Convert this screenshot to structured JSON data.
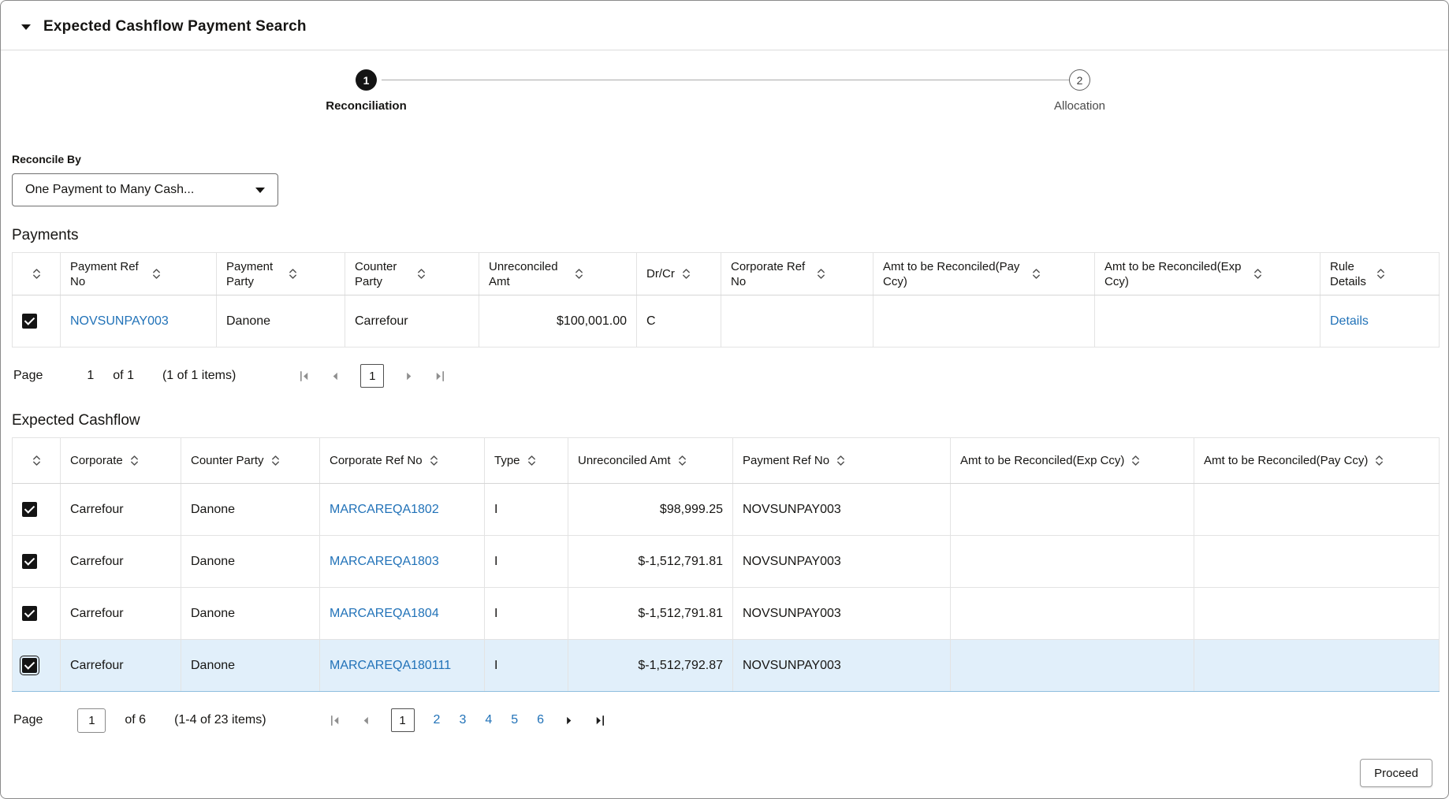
{
  "header": {
    "title": "Expected Cashflow Payment Search"
  },
  "stepper": {
    "steps": [
      {
        "number": "1",
        "label": "Reconciliation",
        "state": "active"
      },
      {
        "number": "2",
        "label": "Allocation",
        "state": "inactive"
      }
    ]
  },
  "reconcile_by": {
    "label": "Reconcile By",
    "value": "One Payment to Many Cash..."
  },
  "payments": {
    "title": "Payments",
    "columns": [
      "Payment Ref No",
      "Payment Party",
      "Counter Party",
      "Unreconciled Amt",
      "Dr/Cr",
      "Corporate Ref No",
      "Amt to be Reconciled(Pay Ccy)",
      "Amt to be Reconciled(Exp Ccy)",
      "Rule Details"
    ],
    "rows": [
      {
        "checked": true,
        "payment_ref_no": "NOVSUNPAY003",
        "payment_party": "Danone",
        "counter_party": "Carrefour",
        "unreconciled_amt": "$100,001.00",
        "dr_cr": "C",
        "corporate_ref_no": "",
        "amt_to_be_reconciled_pay_ccy": "",
        "amt_to_be_reconciled_exp_ccy": "",
        "rule_details": "Details"
      }
    ],
    "pagination": {
      "page_label": "Page",
      "page": "1",
      "of_label": "of 1",
      "items_label": "(1 of 1 items)",
      "pages": [
        "1"
      ]
    }
  },
  "expected_cashflow": {
    "title": "Expected Cashflow",
    "columns": [
      "Corporate",
      "Counter Party",
      "Corporate Ref No",
      "Type",
      "Unreconciled Amt",
      "Payment Ref No",
      "Amt to be Reconciled(Exp Ccy)",
      "Amt to be Reconciled(Pay Ccy)"
    ],
    "rows": [
      {
        "checked": true,
        "selected": false,
        "corporate": "Carrefour",
        "counter_party": "Danone",
        "corporate_ref_no": "MARCAREQA1802",
        "type": "I",
        "unreconciled_amt": "$98,999.25",
        "payment_ref_no": "NOVSUNPAY003",
        "amt_to_be_reconciled_exp_ccy": "",
        "amt_to_be_reconciled_pay_ccy": ""
      },
      {
        "checked": true,
        "selected": false,
        "corporate": "Carrefour",
        "counter_party": "Danone",
        "corporate_ref_no": "MARCAREQA1803",
        "type": "I",
        "unreconciled_amt": "$-1,512,791.81",
        "payment_ref_no": "NOVSUNPAY003",
        "amt_to_be_reconciled_exp_ccy": "",
        "amt_to_be_reconciled_pay_ccy": ""
      },
      {
        "checked": true,
        "selected": false,
        "corporate": "Carrefour",
        "counter_party": "Danone",
        "corporate_ref_no": "MARCAREQA1804",
        "type": "I",
        "unreconciled_amt": "$-1,512,791.81",
        "payment_ref_no": "NOVSUNPAY003",
        "amt_to_be_reconciled_exp_ccy": "",
        "amt_to_be_reconciled_pay_ccy": ""
      },
      {
        "checked": true,
        "selected": true,
        "corporate": "Carrefour",
        "counter_party": "Danone",
        "corporate_ref_no": "MARCAREQA180111",
        "type": "I",
        "unreconciled_amt": "$-1,512,792.87",
        "payment_ref_no": "NOVSUNPAY003",
        "amt_to_be_reconciled_exp_ccy": "",
        "amt_to_be_reconciled_pay_ccy": ""
      }
    ],
    "pagination": {
      "page_label": "Page",
      "page": "1",
      "of_label": "of 6",
      "items_label": "(1-4 of 23 items)",
      "pages": [
        "1",
        "2",
        "3",
        "4",
        "5",
        "6"
      ]
    }
  },
  "footer": {
    "proceed_label": "Proceed"
  },
  "colors": {
    "link": "#2172b8",
    "selected_row_bg": "#e1effa",
    "step_active_bg": "#141414",
    "grid_border": "#e3e3e3"
  },
  "icons": {
    "collapse-caret": "▾",
    "dropdown-caret": "▼",
    "sort": "⇅",
    "page-first": "|◀",
    "page-prev": "◀",
    "page-next": "▶",
    "page-last": "▶|",
    "checkbox-check": "✓"
  }
}
